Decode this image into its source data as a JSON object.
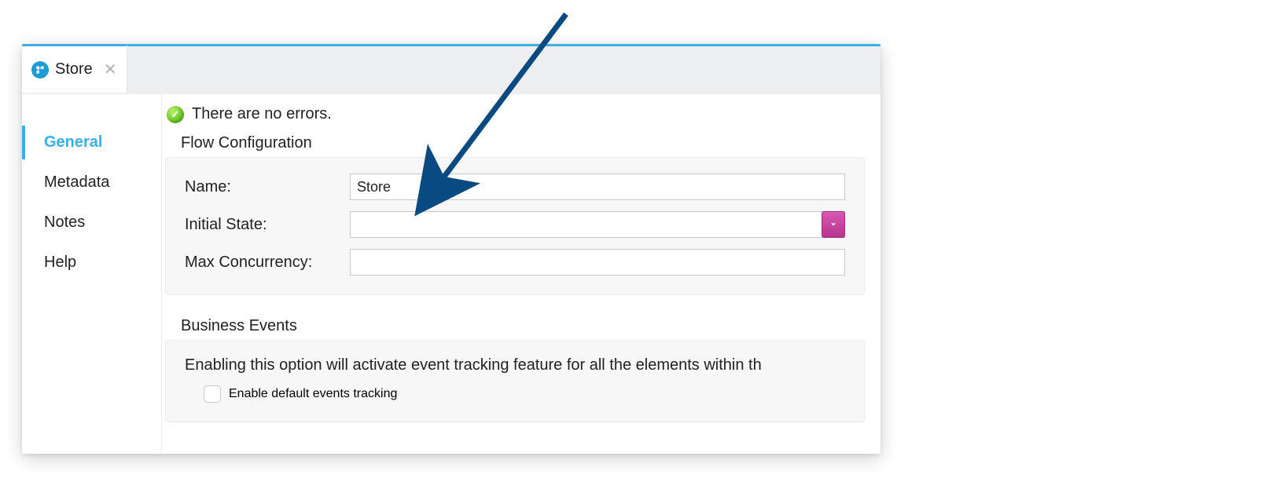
{
  "tab": {
    "label": "Store"
  },
  "sidebar": {
    "items": [
      {
        "label": "General"
      },
      {
        "label": "Metadata"
      },
      {
        "label": "Notes"
      },
      {
        "label": "Help"
      }
    ]
  },
  "status": {
    "message": "There are no errors."
  },
  "flow_config": {
    "title": "Flow Configuration",
    "name_label": "Name:",
    "name_value": "Store",
    "initial_state_label": "Initial State:",
    "initial_state_value": "",
    "max_concurrency_label": "Max Concurrency:",
    "max_concurrency_value": ""
  },
  "business_events": {
    "title": "Business Events",
    "description": "Enabling this option will activate event tracking feature for all the elements within th",
    "checkbox_label": "Enable default events tracking",
    "checkbox_checked": false
  }
}
